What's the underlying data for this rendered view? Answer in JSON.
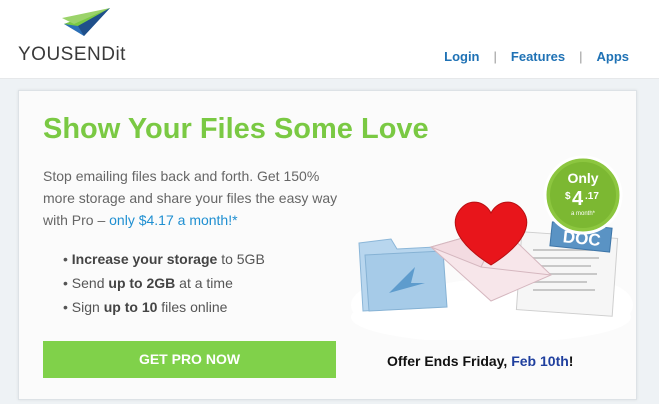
{
  "header": {
    "logo_text": "YOUSENDit",
    "nav": {
      "login": "Login",
      "features": "Features",
      "apps": "Apps",
      "separator": "|"
    }
  },
  "promo": {
    "headline": "Show Your Files Some Love",
    "description": "Stop emailing files back and forth. Get 150% more storage and share your files the easy way with Pro – ",
    "price_link": "only $4.17 a month!*",
    "bullets": [
      {
        "prefix": "Increase your storage",
        "suffix": " to 5GB",
        "bold_first": true
      },
      {
        "prefix": "Send ",
        "bold": "up to 2GB",
        "suffix": " at a time"
      },
      {
        "prefix": "Sign ",
        "bold": "up to 10",
        "suffix": " files online"
      }
    ],
    "cta_label": "GET PRO NOW",
    "offer_prefix": "Offer Ends Friday, ",
    "offer_date": "Feb 10th",
    "offer_suffix": "!"
  },
  "badge": {
    "only": "Only",
    "dollar": "$",
    "amount": "4",
    "cents": ".17",
    "per": "a month*"
  },
  "doc_label": "DOC",
  "colors": {
    "brand_green": "#7ac943",
    "cta_green": "#80d14a",
    "link_blue": "#1f72b5",
    "badge_green": "#8cc63f"
  }
}
